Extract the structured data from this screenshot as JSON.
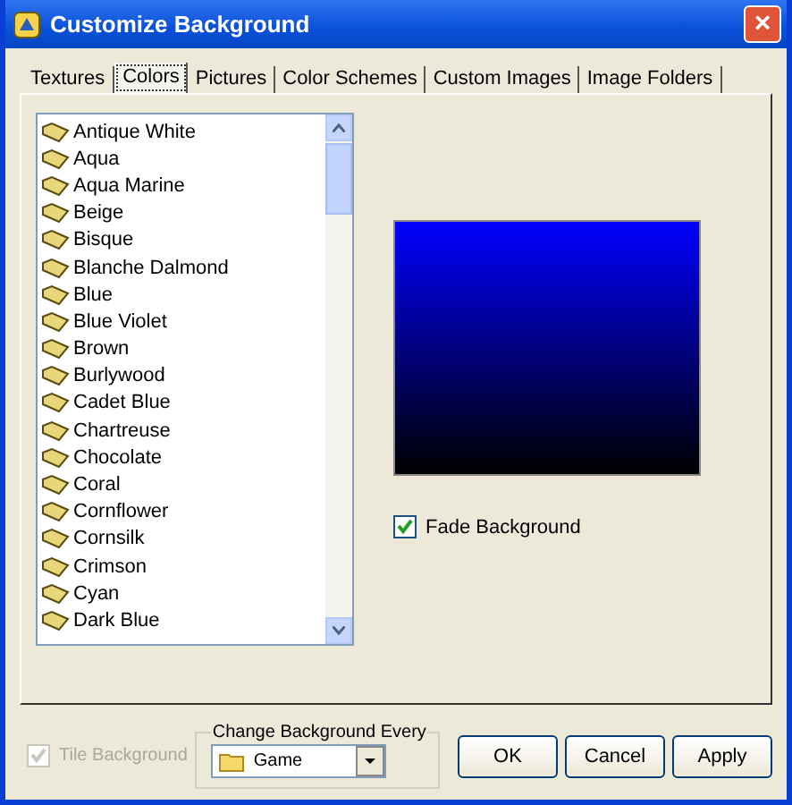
{
  "window": {
    "title": "Customize Background",
    "close": "×"
  },
  "tabs": [
    {
      "label": "Textures",
      "selected": false
    },
    {
      "label": "Colors",
      "selected": true
    },
    {
      "label": "Pictures",
      "selected": false
    },
    {
      "label": "Color Schemes",
      "selected": false
    },
    {
      "label": "Custom Images",
      "selected": false
    },
    {
      "label": "Image Folders",
      "selected": false
    }
  ],
  "colors": [
    "Antique White",
    "Aqua",
    "Aqua Marine",
    "Beige",
    "Bisque",
    "Blanche Dalmond",
    "Blue",
    "Blue Violet",
    "Brown",
    "Burlywood",
    "Cadet Blue",
    "Chartreuse",
    "Chocolate",
    "Coral",
    "Cornflower",
    "Cornsilk",
    "Crimson",
    "Cyan",
    "Dark Blue"
  ],
  "fade_background": {
    "label": "Fade Background",
    "checked": true
  },
  "tile_background": {
    "label": "Tile Background",
    "checked": true,
    "disabled": true
  },
  "change_every": {
    "legend": "Change Background Every",
    "value": "Game"
  },
  "buttons": [
    "OK",
    "Cancel",
    "Apply"
  ]
}
